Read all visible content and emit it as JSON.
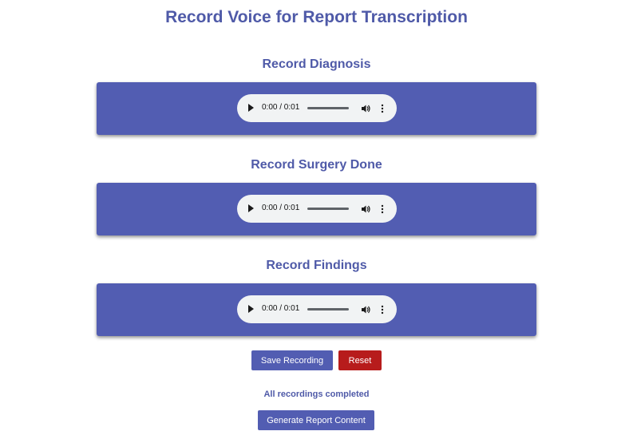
{
  "page": {
    "title": "Record Voice for Report Transcription"
  },
  "sections": [
    {
      "title": "Record Diagnosis",
      "audio": {
        "time": "0:00 / 0:01"
      }
    },
    {
      "title": "Record Surgery Done",
      "audio": {
        "time": "0:00 / 0:01"
      }
    },
    {
      "title": "Record Findings",
      "audio": {
        "time": "0:00 / 0:01"
      }
    }
  ],
  "actions": {
    "save_label": "Save Recording",
    "reset_label": "Reset",
    "status_text": "All recordings completed",
    "generate_label": "Generate Report Content"
  },
  "icons": {
    "play": "play-icon",
    "volume": "volume-icon",
    "more": "more-vertical-icon"
  },
  "colors": {
    "accent": "#525db2",
    "title_text": "#4f5aa8",
    "danger": "#b71c1c",
    "audio_background": "#f1f3f4"
  }
}
